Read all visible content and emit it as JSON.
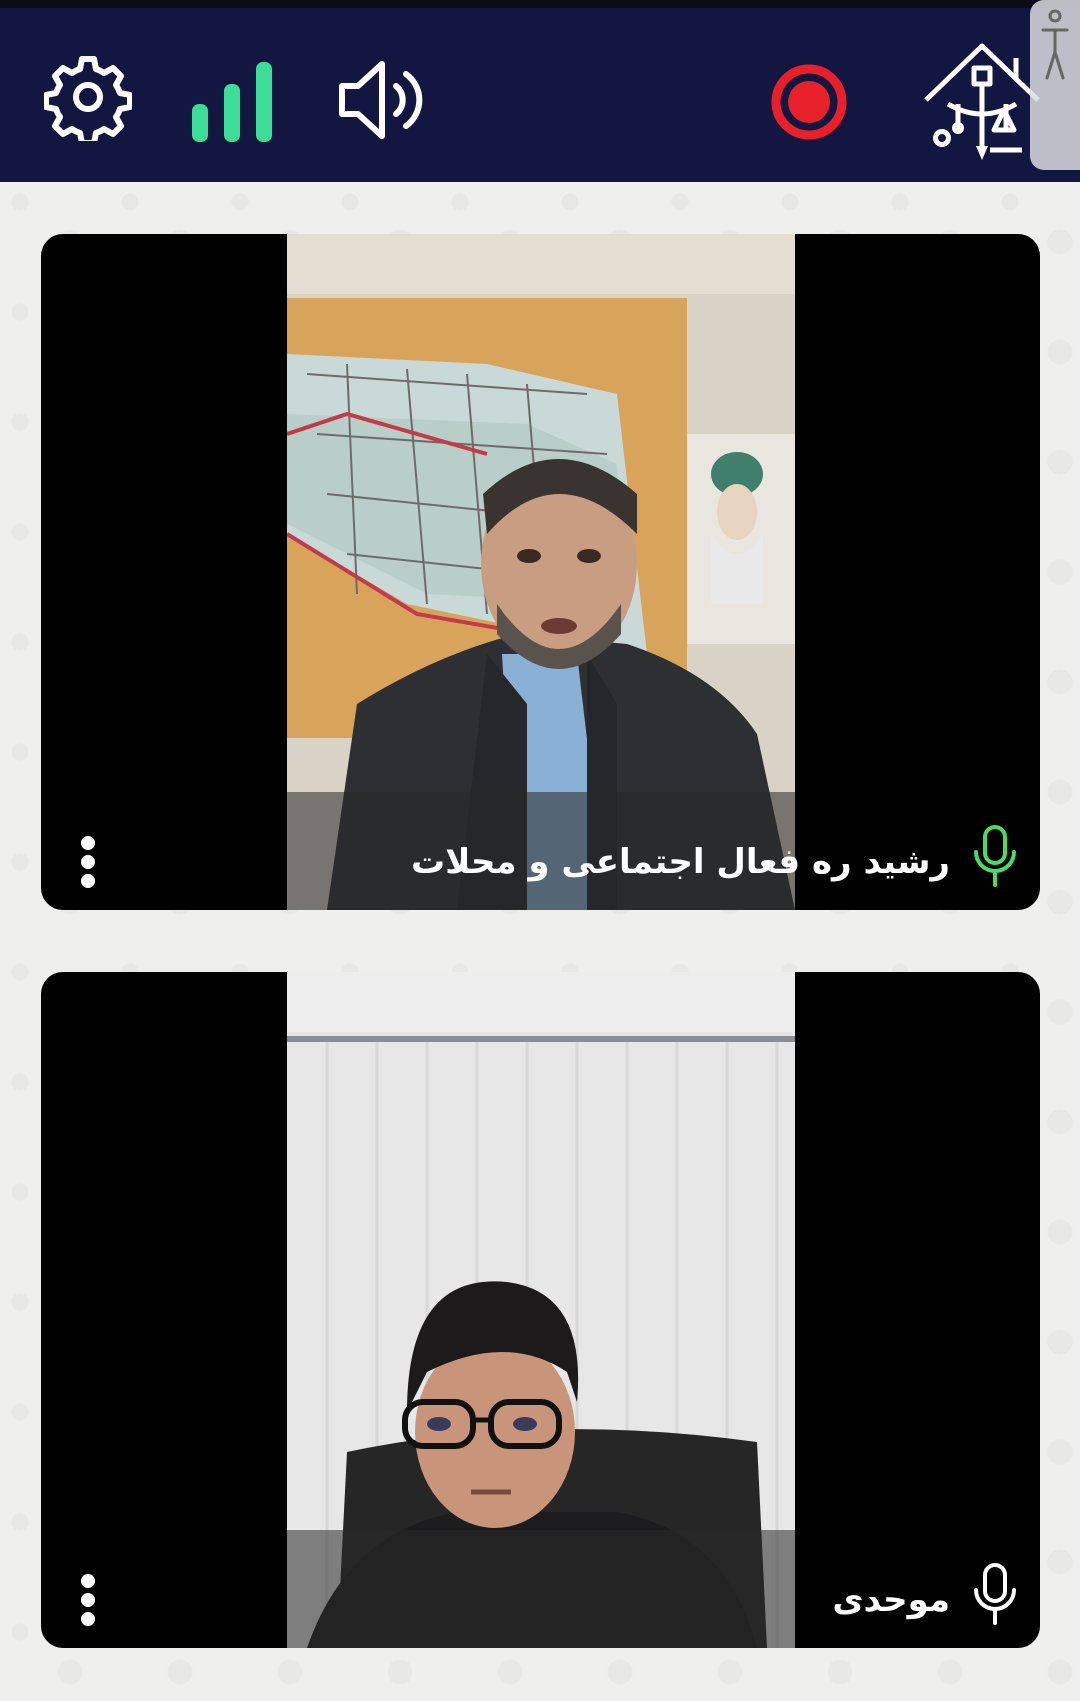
{
  "toolbar": {
    "settings_icon": "gear-icon",
    "connection_icon": "signal-bars-icon",
    "speaker_icon": "speaker-icon",
    "record_icon": "record-icon",
    "logo_icon": "house-justice-logo-icon",
    "accessibility_icon": "accessibility-person-icon"
  },
  "colors": {
    "header_bg": "#121640",
    "signal_green": "#3ddc97",
    "record_red": "#e8202a",
    "mic_active": "#4cd964",
    "page_bg": "#efefee"
  },
  "participants": [
    {
      "name": "رشید ره فعال اجتماعی و محلات",
      "mic_state": "active"
    },
    {
      "name": "موحدی",
      "mic_state": "idle"
    }
  ]
}
